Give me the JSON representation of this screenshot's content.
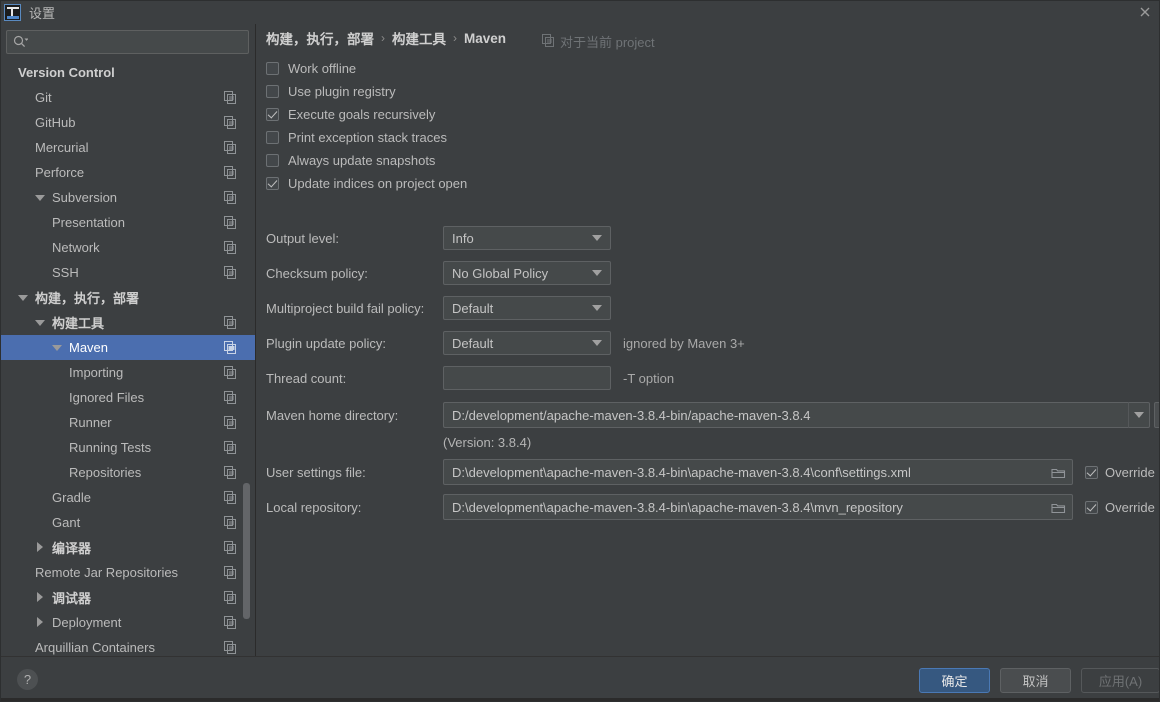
{
  "window": {
    "title": "设置",
    "logo_icon": "intellij-idea-logo",
    "close_icon": "close-icon"
  },
  "sidebar": {
    "search": {
      "placeholder": "",
      "value": "",
      "icon": "search-icon"
    },
    "copy_icon": "copy-settings-icon",
    "items": [
      {
        "label": "Version Control",
        "indent": 0,
        "bold": true,
        "arrow": "none",
        "copy": false,
        "selected": false
      },
      {
        "label": "Git",
        "indent": 1,
        "bold": false,
        "arrow": "none",
        "copy": true,
        "selected": false
      },
      {
        "label": "GitHub",
        "indent": 1,
        "bold": false,
        "arrow": "none",
        "copy": true,
        "selected": false
      },
      {
        "label": "Mercurial",
        "indent": 1,
        "bold": false,
        "arrow": "none",
        "copy": true,
        "selected": false
      },
      {
        "label": "Perforce",
        "indent": 1,
        "bold": false,
        "arrow": "none",
        "copy": true,
        "selected": false
      },
      {
        "label": "Subversion",
        "indent": 1,
        "bold": false,
        "arrow": "down",
        "copy": true,
        "selected": false
      },
      {
        "label": "Presentation",
        "indent": 2,
        "bold": false,
        "arrow": "none",
        "copy": true,
        "selected": false
      },
      {
        "label": "Network",
        "indent": 2,
        "bold": false,
        "arrow": "none",
        "copy": true,
        "selected": false
      },
      {
        "label": "SSH",
        "indent": 2,
        "bold": false,
        "arrow": "none",
        "copy": true,
        "selected": false
      },
      {
        "label": "构建，执行，部署",
        "indent": 0,
        "bold": true,
        "arrow": "down",
        "copy": false,
        "selected": false
      },
      {
        "label": "构建工具",
        "indent": 1,
        "bold": true,
        "arrow": "down",
        "copy": true,
        "selected": false
      },
      {
        "label": "Maven",
        "indent": 2,
        "bold": false,
        "arrow": "down",
        "copy": true,
        "selected": true
      },
      {
        "label": "Importing",
        "indent": 3,
        "bold": false,
        "arrow": "none",
        "copy": true,
        "selected": false
      },
      {
        "label": "Ignored Files",
        "indent": 3,
        "bold": false,
        "arrow": "none",
        "copy": true,
        "selected": false
      },
      {
        "label": "Runner",
        "indent": 3,
        "bold": false,
        "arrow": "none",
        "copy": true,
        "selected": false
      },
      {
        "label": "Running Tests",
        "indent": 3,
        "bold": false,
        "arrow": "none",
        "copy": true,
        "selected": false
      },
      {
        "label": "Repositories",
        "indent": 3,
        "bold": false,
        "arrow": "none",
        "copy": true,
        "selected": false
      },
      {
        "label": "Gradle",
        "indent": 2,
        "bold": false,
        "arrow": "none",
        "copy": true,
        "selected": false
      },
      {
        "label": "Gant",
        "indent": 2,
        "bold": false,
        "arrow": "none",
        "copy": true,
        "selected": false
      },
      {
        "label": "编译器",
        "indent": 1,
        "bold": true,
        "arrow": "right",
        "copy": true,
        "selected": false
      },
      {
        "label": "Remote Jar Repositories",
        "indent": 1,
        "bold": false,
        "arrow": "none",
        "copy": true,
        "selected": false
      },
      {
        "label": "调试器",
        "indent": 1,
        "bold": true,
        "arrow": "right",
        "copy": true,
        "selected": false
      },
      {
        "label": "Deployment",
        "indent": 1,
        "bold": false,
        "arrow": "right",
        "copy": true,
        "selected": false
      },
      {
        "label": "Arquillian Containers",
        "indent": 1,
        "bold": false,
        "arrow": "none",
        "copy": true,
        "selected": false
      }
    ],
    "selection_color": "#4b6eaf"
  },
  "main": {
    "breadcrumb": [
      "构建，执行，部署",
      "构建工具",
      "Maven"
    ],
    "breadcrumb_separator": "›",
    "scope_note": "对于当前 project",
    "scope_icon": "project-scope-icon",
    "checkboxes": [
      {
        "label": "Work offline",
        "checked": false
      },
      {
        "label": "Use plugin registry",
        "checked": false
      },
      {
        "label": "Execute goals recursively",
        "checked": true
      },
      {
        "label": "Print exception stack traces",
        "checked": false
      },
      {
        "label": "Always update snapshots",
        "checked": false
      },
      {
        "label": "Update indices on project open",
        "checked": true
      }
    ],
    "combos": [
      {
        "label": "Output level:",
        "value": "Info",
        "note": ""
      },
      {
        "label": "Checksum policy:",
        "value": "No Global Policy",
        "note": ""
      },
      {
        "label": "Multiproject build fail policy:",
        "value": "Default",
        "note": ""
      },
      {
        "label": "Plugin update policy:",
        "value": "Default",
        "note": "ignored by Maven 3+"
      }
    ],
    "thread_count": {
      "label": "Thread count:",
      "value": "",
      "note": "-T option"
    },
    "maven_home": {
      "label": "Maven home directory:",
      "value": "D:/development/apache-maven-3.8.4-bin/apache-maven-3.8.4",
      "browse_label": "…"
    },
    "version_note": "(Version: 3.8.4)",
    "user_settings": {
      "label": "User settings file:",
      "value": "D:\\development\\apache-maven-3.8.4-bin\\apache-maven-3.8.4\\conf\\settings.xml",
      "override_label": "Override",
      "override_checked": true,
      "folder_icon": "folder-icon"
    },
    "local_repository": {
      "label": "Local repository:",
      "value": "D:\\development\\apache-maven-3.8.4-bin\\apache-maven-3.8.4\\mvn_repository",
      "override_label": "Override",
      "override_checked": true,
      "folder_icon": "folder-icon"
    }
  },
  "footer": {
    "help_label": "?",
    "ok_label": "确定",
    "cancel_label": "取消",
    "apply_label": "应用(A)",
    "accent_color": "#365880"
  }
}
